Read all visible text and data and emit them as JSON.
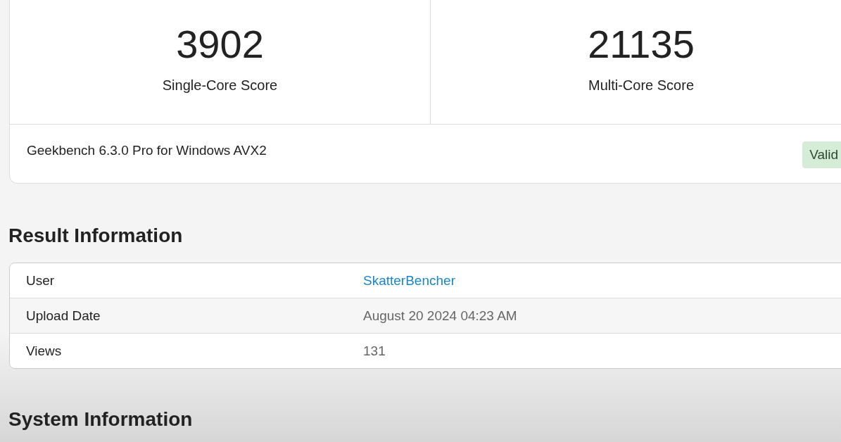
{
  "scores": [
    {
      "value": "3902",
      "label": "Single-Core Score"
    },
    {
      "value": "21135",
      "label": "Multi-Core Score"
    }
  ],
  "version": "Geekbench 6.3.0 Pro for Windows AVX2",
  "badge": "Valid",
  "result_information": {
    "heading": "Result Information",
    "rows": [
      {
        "label": "User",
        "value": "SkatterBencher",
        "kind": "link"
      },
      {
        "label": "Upload Date",
        "value": "August 20 2024 04:23 AM",
        "kind": "text"
      },
      {
        "label": "Views",
        "value": "131",
        "kind": "text"
      }
    ]
  },
  "system_information": {
    "heading": "System Information"
  }
}
